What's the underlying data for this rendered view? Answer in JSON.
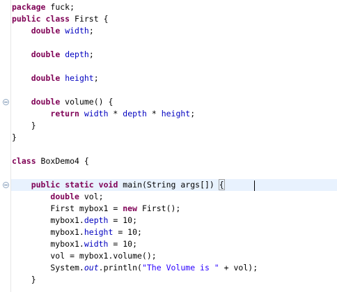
{
  "lines": [
    {
      "t": [
        {
          "k": "kw",
          "s": "package"
        },
        {
          "s": " fuck;"
        }
      ]
    },
    {
      "t": [
        {
          "k": "kw",
          "s": "public"
        },
        {
          "s": " "
        },
        {
          "k": "kw",
          "s": "class"
        },
        {
          "s": " First {"
        }
      ]
    },
    {
      "t": [
        {
          "s": "    "
        },
        {
          "k": "kw",
          "s": "double"
        },
        {
          "s": " "
        },
        {
          "k": "fld",
          "s": "width"
        },
        {
          "s": ";"
        }
      ]
    },
    {
      "t": [
        {
          "s": ""
        }
      ]
    },
    {
      "t": [
        {
          "s": "    "
        },
        {
          "k": "kw",
          "s": "double"
        },
        {
          "s": " "
        },
        {
          "k": "fld",
          "s": "depth"
        },
        {
          "s": ";"
        }
      ]
    },
    {
      "t": [
        {
          "s": ""
        }
      ]
    },
    {
      "t": [
        {
          "s": "    "
        },
        {
          "k": "kw",
          "s": "double"
        },
        {
          "s": " "
        },
        {
          "k": "fld",
          "s": "height"
        },
        {
          "s": ";"
        }
      ]
    },
    {
      "t": [
        {
          "s": ""
        }
      ]
    },
    {
      "t": [
        {
          "s": "    "
        },
        {
          "k": "kw",
          "s": "double"
        },
        {
          "s": " volume() {"
        }
      ]
    },
    {
      "t": [
        {
          "s": "        "
        },
        {
          "k": "kw",
          "s": "return"
        },
        {
          "s": " "
        },
        {
          "k": "fld",
          "s": "width"
        },
        {
          "s": " * "
        },
        {
          "k": "fld",
          "s": "depth"
        },
        {
          "s": " * "
        },
        {
          "k": "fld",
          "s": "height"
        },
        {
          "s": ";"
        }
      ]
    },
    {
      "t": [
        {
          "s": "    }"
        }
      ]
    },
    {
      "t": [
        {
          "s": "}"
        }
      ]
    },
    {
      "t": [
        {
          "s": ""
        }
      ]
    },
    {
      "t": [
        {
          "k": "kw",
          "s": "class"
        },
        {
          "s": " BoxDemo4 {"
        }
      ]
    },
    {
      "t": [
        {
          "s": ""
        }
      ]
    },
    {
      "t": [
        {
          "s": "    "
        },
        {
          "k": "kw",
          "s": "public"
        },
        {
          "s": " "
        },
        {
          "k": "kw",
          "s": "static"
        },
        {
          "s": " "
        },
        {
          "k": "kw",
          "s": "void"
        },
        {
          "s": " main(String args[]) "
        },
        {
          "k": "bracket-match",
          "s": "{"
        }
      ]
    },
    {
      "t": [
        {
          "s": "        "
        },
        {
          "k": "kw",
          "s": "double"
        },
        {
          "s": " vol;"
        }
      ]
    },
    {
      "t": [
        {
          "s": "        First mybox1 = "
        },
        {
          "k": "kw",
          "s": "new"
        },
        {
          "s": " First();"
        }
      ]
    },
    {
      "t": [
        {
          "s": "        mybox1."
        },
        {
          "k": "fld",
          "s": "depth"
        },
        {
          "s": " = 10;"
        }
      ]
    },
    {
      "t": [
        {
          "s": "        mybox1."
        },
        {
          "k": "fld",
          "s": "height"
        },
        {
          "s": " = 10;"
        }
      ]
    },
    {
      "t": [
        {
          "s": "        mybox1."
        },
        {
          "k": "fld",
          "s": "width"
        },
        {
          "s": " = 10;"
        }
      ]
    },
    {
      "t": [
        {
          "s": "        vol = mybox1.volume();"
        }
      ]
    },
    {
      "t": [
        {
          "s": "        System."
        },
        {
          "k": "sfld",
          "s": "out"
        },
        {
          "s": ".println("
        },
        {
          "k": "str",
          "s": "\"The Volume is \""
        },
        {
          "s": " + vol);"
        }
      ]
    },
    {
      "t": [
        {
          "s": "    }"
        }
      ]
    }
  ],
  "current_line": 15,
  "fold_markers": [
    8,
    15
  ],
  "colors": {
    "keyword": "#7f0055",
    "field": "#0000c0",
    "string": "#2a00ff",
    "current_line_bg": "#e8f2fe"
  }
}
